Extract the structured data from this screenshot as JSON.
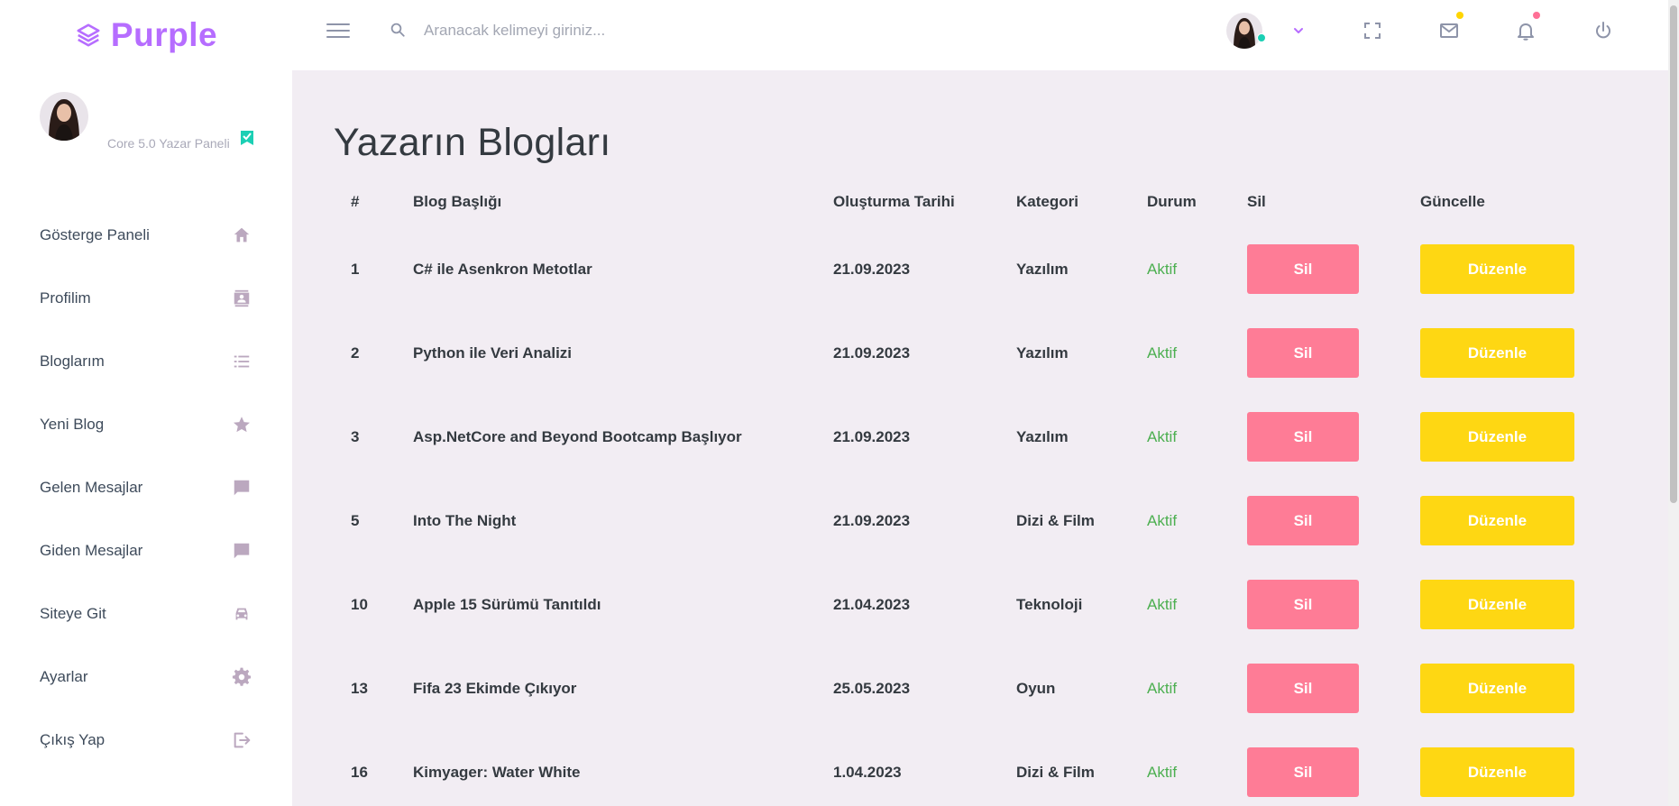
{
  "brand": {
    "name": "Purple"
  },
  "search": {
    "placeholder": "Aranacak kelimeyi giriniz..."
  },
  "navbar": {
    "icons": [
      "menu-icon",
      "search-icon",
      "chevron-down-icon",
      "fullscreen-icon",
      "mail-icon",
      "bell-icon",
      "power-icon"
    ],
    "colors": {
      "mail_dot": "#ffd500",
      "bell_dot": "#fe7096"
    }
  },
  "profile": {
    "role": "Core 5.0 Yazar Paneli"
  },
  "sidebar": {
    "items": [
      {
        "label": "Gösterge Paneli",
        "icon": "home-icon"
      },
      {
        "label": "Profilim",
        "icon": "contact-card-icon"
      },
      {
        "label": "Bloglarım",
        "icon": "list-icon"
      },
      {
        "label": "Yeni Blog",
        "icon": "star-icon"
      },
      {
        "label": "Gelen Mesajlar",
        "icon": "message-icon"
      },
      {
        "label": "Giden Mesajlar",
        "icon": "message-icon"
      },
      {
        "label": "Siteye Git",
        "icon": "car-icon"
      },
      {
        "label": "Ayarlar",
        "icon": "gear-icon"
      },
      {
        "label": "Çıkış Yap",
        "icon": "logout-icon"
      }
    ]
  },
  "page": {
    "title": "Yazarın Blogları"
  },
  "table": {
    "headers": [
      "#",
      "Blog Başlığı",
      "Oluşturma Tarihi",
      "Kategori",
      "Durum",
      "Sil",
      "Güncelle"
    ],
    "rows": [
      {
        "id": "1",
        "title": "C# ile Asenkron Metotlar",
        "date": "21.09.2023",
        "category": "Yazılım",
        "status": "Aktif",
        "delete": "Sil",
        "edit": "Düzenle"
      },
      {
        "id": "2",
        "title": "Python ile Veri Analizi",
        "date": "21.09.2023",
        "category": "Yazılım",
        "status": "Aktif",
        "delete": "Sil",
        "edit": "Düzenle"
      },
      {
        "id": "3",
        "title": "Asp.NetCore and Beyond Bootcamp Başlıyor",
        "date": "21.09.2023",
        "category": "Yazılım",
        "status": "Aktif",
        "delete": "Sil",
        "edit": "Düzenle"
      },
      {
        "id": "5",
        "title": "Into The Night",
        "date": "21.09.2023",
        "category": "Dizi & Film",
        "status": "Aktif",
        "delete": "Sil",
        "edit": "Düzenle"
      },
      {
        "id": "10",
        "title": "Apple 15 Sürümü Tanıtıldı",
        "date": "21.04.2023",
        "category": "Teknoloji",
        "status": "Aktif",
        "delete": "Sil",
        "edit": "Düzenle"
      },
      {
        "id": "13",
        "title": "Fifa 23 Ekimde Çıkıyor",
        "date": "25.05.2023",
        "category": "Oyun",
        "status": "Aktif",
        "delete": "Sil",
        "edit": "Düzenle"
      },
      {
        "id": "16",
        "title": "Kimyager: Water White",
        "date": "1.04.2023",
        "category": "Dizi & Film",
        "status": "Aktif",
        "delete": "Sil",
        "edit": "Düzenle"
      }
    ]
  },
  "colors": {
    "brand": "#b66dff",
    "background": "#f2edf3",
    "danger": "#fe7c96",
    "warning": "#fed713",
    "status_active": "#4caf50",
    "sidebar_icon": "#bba8bf",
    "online": "#1bcfb4"
  }
}
